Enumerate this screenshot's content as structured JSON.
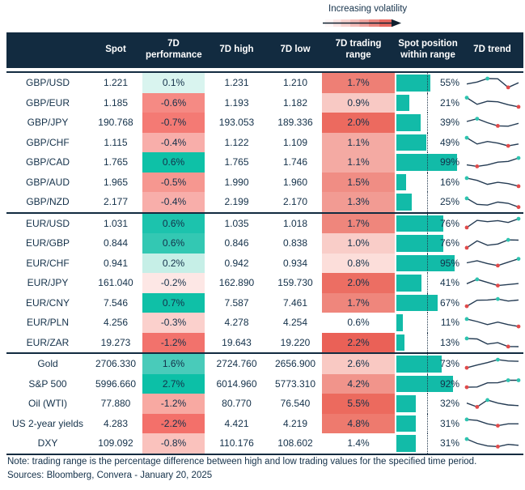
{
  "legend": {
    "label": "Increasing volatility"
  },
  "footer": {
    "note": "Note: trading range is the percentage difference between high and low trading values for the specified time period.",
    "sources": "Sources: Bloomberg, Convera - January 20, 2025"
  },
  "colors": {
    "header_bg": "#122b40",
    "text_navy": "#14314a",
    "bar_teal": "#12bba8",
    "dot_teal": "#2ec4b0",
    "dot_red": "#e04b4b",
    "trend_line": "#243b53",
    "divider_navy": "#122b40",
    "volatility_red": "#e4574e",
    "midline_dotted": "#22384d"
  },
  "chart_data": {
    "type": "table",
    "columns": [
      "",
      "Spot",
      "7D performance",
      "7D high",
      "7D low",
      "7D trading range",
      "Spot position within range",
      "7D trend"
    ],
    "position_midline_pct": 50,
    "sections": [
      {
        "rows": [
          {
            "pair": "GBP/USD",
            "spot": "1.221",
            "perf": "0.1%",
            "perf_bg": "#d9f4ef",
            "high": "1.231",
            "low": "1.210",
            "range": "1.7%",
            "range_bg": "#ee7f75",
            "position_pct": 55,
            "position_label": "55%",
            "trend": {
              "points": [
                0.42,
                0.58,
                0.86,
                0.84,
                0.15,
                0.52
              ],
              "dots": [
                {
                  "i": 2,
                  "color": "teal"
                },
                {
                  "i": 4,
                  "color": "red"
                }
              ]
            }
          },
          {
            "pair": "GBP/EUR",
            "spot": "1.185",
            "perf": "-0.6%",
            "perf_bg": "#f58a84",
            "high": "1.193",
            "low": "1.182",
            "range": "0.9%",
            "range_bg": "#f8c9c4",
            "position_pct": 21,
            "position_label": "21%",
            "trend": {
              "points": [
                0.88,
                0.35,
                0.6,
                0.55,
                0.32,
                0.15
              ],
              "dots": [
                {
                  "i": 0,
                  "color": "teal"
                },
                {
                  "i": 5,
                  "color": "red"
                }
              ]
            }
          },
          {
            "pair": "GBP/JPY",
            "spot": "190.768",
            "perf": "-0.7%",
            "perf_bg": "#f47a74",
            "high": "193.053",
            "low": "189.336",
            "range": "2.0%",
            "range_bg": "#ec6a5f",
            "position_pct": 39,
            "position_label": "39%",
            "trend": {
              "points": [
                0.6,
                0.82,
                0.5,
                0.25,
                0.22,
                0.45
              ],
              "dots": [
                {
                  "i": 1,
                  "color": "teal"
                },
                {
                  "i": 3,
                  "color": "red"
                }
              ]
            }
          },
          {
            "pair": "GBP/CHF",
            "spot": "1.115",
            "perf": "-0.4%",
            "perf_bg": "#f8aeaa",
            "high": "1.122",
            "low": "1.109",
            "range": "1.1%",
            "range_bg": "#f4aaa3",
            "position_pct": 49,
            "position_label": "49%",
            "trend": {
              "points": [
                0.85,
                0.35,
                0.55,
                0.42,
                0.2,
                0.35
              ],
              "dots": [
                {
                  "i": 0,
                  "color": "teal"
                },
                {
                  "i": 4,
                  "color": "red"
                }
              ]
            }
          },
          {
            "pair": "GBP/CAD",
            "spot": "1.765",
            "perf": "0.6%",
            "perf_bg": "#0ec1a7",
            "high": "1.765",
            "low": "1.746",
            "range": "1.1%",
            "range_bg": "#f4aaa3",
            "position_pct": 99,
            "position_label": "99%",
            "trend": {
              "points": [
                0.3,
                0.18,
                0.3,
                0.52,
                0.58,
                0.85
              ],
              "dots": [
                {
                  "i": 5,
                  "color": "teal"
                },
                {
                  "i": 1,
                  "color": "red"
                }
              ]
            }
          },
          {
            "pair": "GBP/AUD",
            "spot": "1.965",
            "perf": "-0.5%",
            "perf_bg": "#f69790",
            "high": "1.990",
            "low": "1.960",
            "range": "1.5%",
            "range_bg": "#f08d84",
            "position_pct": 16,
            "position_label": "16%",
            "trend": {
              "points": [
                0.8,
                0.62,
                0.3,
                0.46,
                0.36,
                0.15
              ],
              "dots": [
                {
                  "i": 0,
                  "color": "teal"
                },
                {
                  "i": 5,
                  "color": "red"
                }
              ]
            }
          },
          {
            "pair": "GBP/NZD",
            "spot": "2.177",
            "perf": "-0.4%",
            "perf_bg": "#f8aeaa",
            "high": "2.199",
            "low": "2.170",
            "range": "1.3%",
            "range_bg": "#f29b93",
            "position_pct": 25,
            "position_label": "25%",
            "trend": {
              "points": [
                0.8,
                0.32,
                0.26,
                0.5,
                0.4,
                0.1
              ],
              "dots": [
                {
                  "i": 0,
                  "color": "teal"
                },
                {
                  "i": 5,
                  "color": "red"
                }
              ]
            }
          }
        ]
      },
      {
        "rows": [
          {
            "pair": "EUR/USD",
            "spot": "1.031",
            "perf": "0.6%",
            "perf_bg": "#1cc3ad",
            "high": "1.035",
            "low": "1.018",
            "range": "1.7%",
            "range_bg": "#ef867c",
            "position_pct": 76,
            "position_label": "76%",
            "trend": {
              "points": [
                0.15,
                0.72,
                0.62,
                0.7,
                0.55,
                0.85
              ],
              "dots": [
                {
                  "i": 5,
                  "color": "teal"
                },
                {
                  "i": 0,
                  "color": "red"
                }
              ]
            }
          },
          {
            "pair": "EUR/GBP",
            "spot": "0.844",
            "perf": "0.6%",
            "perf_bg": "#33c8b3",
            "high": "0.846",
            "low": "0.838",
            "range": "1.0%",
            "range_bg": "#f9cdc8",
            "position_pct": 76,
            "position_label": "76%",
            "trend": {
              "points": [
                0.15,
                0.7,
                0.35,
                0.45,
                0.78,
                0.76
              ],
              "dots": [
                {
                  "i": 4,
                  "color": "teal"
                },
                {
                  "i": 0,
                  "color": "red"
                }
              ]
            }
          },
          {
            "pair": "EUR/CHF",
            "spot": "0.941",
            "perf": "0.2%",
            "perf_bg": "#c6efe7",
            "high": "0.942",
            "low": "0.934",
            "range": "0.8%",
            "range_bg": "#fcdeda",
            "position_pct": 95,
            "position_label": "95%",
            "trend": {
              "points": [
                0.5,
                0.66,
                0.44,
                0.28,
                0.55,
                0.82
              ],
              "dots": [
                {
                  "i": 5,
                  "color": "teal"
                },
                {
                  "i": 3,
                  "color": "red"
                }
              ]
            }
          },
          {
            "pair": "EUR/JPY",
            "spot": "161.040",
            "perf": "-0.2%",
            "perf_bg": "#fde7e5",
            "high": "162.890",
            "low": "159.730",
            "range": "2.0%",
            "range_bg": "#ec6e63",
            "position_pct": 41,
            "position_label": "41%",
            "trend": {
              "points": [
                0.45,
                0.8,
                0.55,
                0.3,
                0.38,
                0.46
              ],
              "dots": [
                {
                  "i": 1,
                  "color": "teal"
                },
                {
                  "i": 3,
                  "color": "red"
                }
              ]
            }
          },
          {
            "pair": "EUR/CNY",
            "spot": "7.546",
            "perf": "0.7%",
            "perf_bg": "#0fc0a7",
            "high": "7.587",
            "low": "7.461",
            "range": "1.7%",
            "range_bg": "#ef867c",
            "position_pct": 67,
            "position_label": "67%",
            "trend": {
              "points": [
                0.2,
                0.68,
                0.7,
                0.78,
                0.62,
                0.7
              ],
              "dots": [
                {
                  "i": 3,
                  "color": "teal"
                },
                {
                  "i": 0,
                  "color": "red"
                }
              ]
            }
          },
          {
            "pair": "EUR/PLN",
            "spot": "4.256",
            "perf": "-0.3%",
            "perf_bg": "#fbd0cc",
            "high": "4.278",
            "low": "4.254",
            "range": "0.6%",
            "range_bg": "#ffffff",
            "position_pct": 11,
            "position_label": "11%",
            "trend": {
              "points": [
                0.8,
                0.6,
                0.35,
                0.55,
                0.35,
                0.2
              ],
              "dots": [
                {
                  "i": 0,
                  "color": "teal"
                },
                {
                  "i": 5,
                  "color": "red"
                }
              ]
            }
          },
          {
            "pair": "EUR/ZAR",
            "spot": "19.273",
            "perf": "-1.2%",
            "perf_bg": "#f2726c",
            "high": "19.643",
            "low": "19.220",
            "range": "2.2%",
            "range_bg": "#ea6157",
            "position_pct": 13,
            "position_label": "13%",
            "trend": {
              "points": [
                0.8,
                0.76,
                0.35,
                0.46,
                0.15,
                0.14
              ],
              "dots": [
                {
                  "i": 0,
                  "color": "teal"
                },
                {
                  "i": 4,
                  "color": "red"
                }
              ]
            }
          }
        ]
      },
      {
        "rows": [
          {
            "pair": "Gold",
            "spot": "2706.330",
            "perf": "1.6%",
            "perf_bg": "#49cbba",
            "high": "2724.760",
            "low": "2656.900",
            "range": "2.6%",
            "range_bg": "#f9c9c3",
            "position_pct": 73,
            "position_label": "73%",
            "trend": {
              "points": [
                0.2,
                0.42,
                0.62,
                0.85,
                0.75,
                0.72
              ],
              "dots": [
                {
                  "i": 3,
                  "color": "teal"
                },
                {
                  "i": 0,
                  "color": "red"
                }
              ]
            }
          },
          {
            "pair": "S&P 500",
            "spot": "5996.660",
            "perf": "2.7%",
            "perf_bg": "#0cc0a7",
            "high": "6014.960",
            "low": "5773.310",
            "range": "4.2%",
            "range_bg": "#f1948b",
            "position_pct": 92,
            "position_label": "92%",
            "trend": {
              "points": [
                0.2,
                0.22,
                0.55,
                0.56,
                0.76,
                0.76
              ],
              "dots": [
                {
                  "i": 4,
                  "color": "teal"
                },
                {
                  "i": 5,
                  "color": "teal"
                },
                {
                  "i": 0,
                  "color": "red"
                }
              ]
            }
          },
          {
            "pair": "Oil (WTI)",
            "spot": "77.880",
            "perf": "-1.2%",
            "perf_bg": "#f8a9a2",
            "high": "80.770",
            "low": "76.540",
            "range": "5.5%",
            "range_bg": "#ec6a5e",
            "position_pct": 32,
            "position_label": "32%",
            "trend": {
              "points": [
                0.55,
                0.25,
                0.8,
                0.55,
                0.4,
                0.35
              ],
              "dots": [
                {
                  "i": 2,
                  "color": "teal"
                },
                {
                  "i": 1,
                  "color": "red"
                }
              ]
            }
          },
          {
            "pair": "US 2-year yields",
            "spot": "4.283",
            "perf": "-2.2%",
            "perf_bg": "#f3706a",
            "high": "4.421",
            "low": "4.219",
            "range": "4.8%",
            "range_bg": "#ee7a6e",
            "position_pct": 31,
            "position_label": "31%",
            "trend": {
              "points": [
                0.8,
                0.72,
                0.45,
                0.3,
                0.45,
                0.45
              ],
              "dots": [
                {
                  "i": 0,
                  "color": "teal"
                },
                {
                  "i": 3,
                  "color": "red"
                }
              ]
            }
          },
          {
            "pair": "DXY",
            "spot": "109.092",
            "perf": "-0.8%",
            "perf_bg": "#fac2bd",
            "high": "110.176",
            "low": "108.602",
            "range": "1.4%",
            "range_bg": "#ffffff",
            "position_pct": 31,
            "position_label": "31%",
            "trend": {
              "points": [
                0.85,
                0.5,
                0.3,
                0.25,
                0.42,
                0.35
              ],
              "dots": [
                {
                  "i": 0,
                  "color": "teal"
                },
                {
                  "i": 3,
                  "color": "red"
                }
              ]
            }
          }
        ]
      }
    ]
  }
}
